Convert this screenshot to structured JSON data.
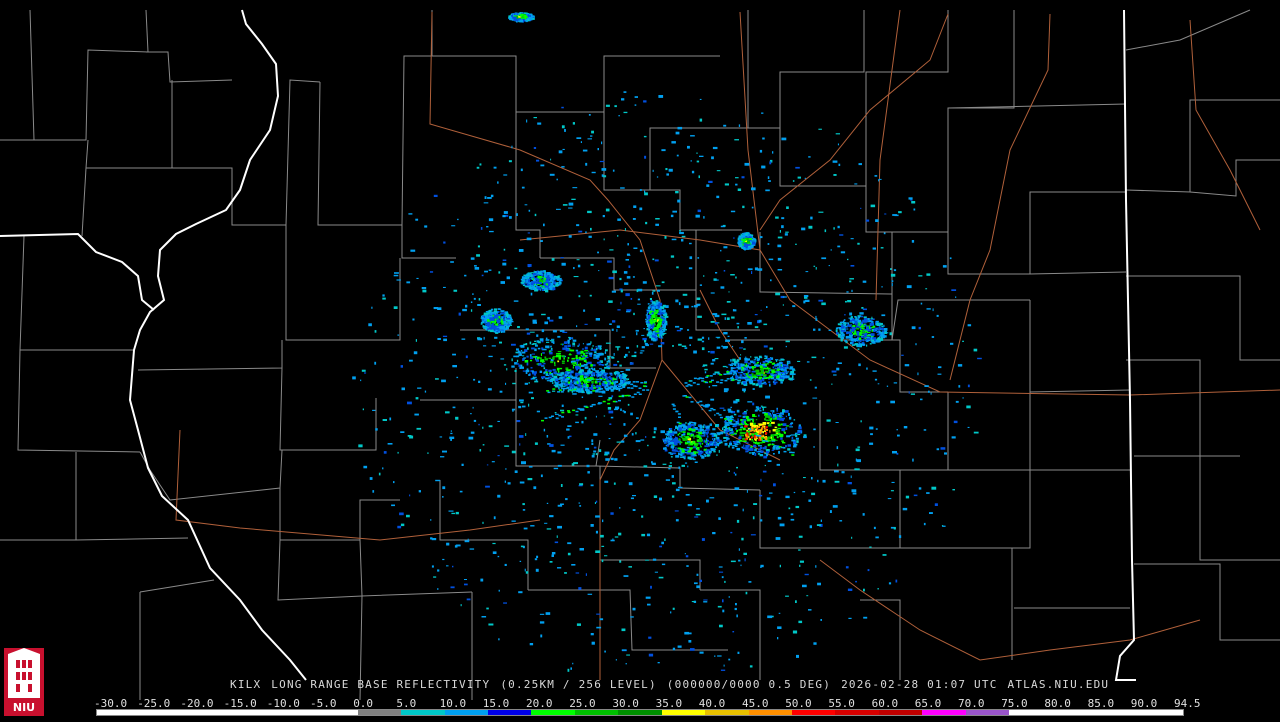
{
  "title": {
    "station": "KILX",
    "product": "LONG RANGE BASE REFLECTIVITY",
    "resolution": "(0.25KM / 256 LEVEL)",
    "scan": "(000000/0000 0.5 DEG)",
    "datetime": "2026-02-28 01:07 UTC",
    "site": "ATLAS.NIU.EDU"
  },
  "logo": {
    "text": "NIU",
    "color": "#c8102e",
    "icon": "niu-tower-logo"
  },
  "scale": {
    "labels": [
      "-30.0",
      "-25.0",
      "-20.0",
      "-15.0",
      "-10.0",
      "-5.0",
      "0.0",
      "5.0",
      "10.0",
      "15.0",
      "20.0",
      "25.0",
      "30.0",
      "35.0",
      "40.0",
      "45.0",
      "50.0",
      "55.0",
      "60.0",
      "65.0",
      "70.0",
      "75.0",
      "80.0",
      "85.0",
      "90.0",
      "94.5"
    ],
    "colors": [
      "#ffffff",
      "#ffffff",
      "#ffffff",
      "#ffffff",
      "#ffffff",
      "#ffffff",
      "#7f7f7f",
      "#00c8c8",
      "#00a0f0",
      "#0000e8",
      "#00ff00",
      "#00c000",
      "#009000",
      "#ffff00",
      "#e7c000",
      "#ff9000",
      "#ff0000",
      "#d60000",
      "#c00000",
      "#ff00ff",
      "#9955c9",
      "#ffffff",
      "#ffffff",
      "#ffffff",
      "#ffffff"
    ]
  },
  "map_colors": {
    "background": "#000000",
    "county_lines": "#8a8a8a",
    "state_lines": "#ffffff",
    "roads": "#b0603a"
  },
  "echo_colors": [
    "#00c8c8",
    "#00a0f0",
    "#0050e0",
    "#00ff00",
    "#00c000",
    "#ffff00",
    "#ff9000",
    "#ff0000"
  ]
}
